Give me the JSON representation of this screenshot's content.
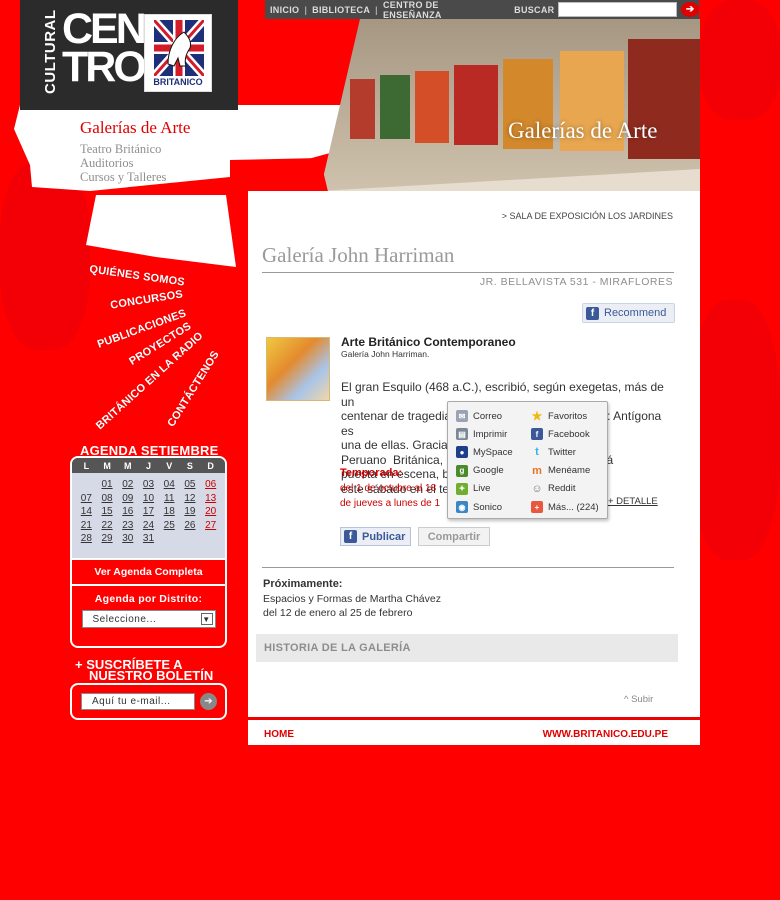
{
  "topnav": {
    "links": [
      "INICIO",
      "BIBLIOTECA",
      "CENTRO DE ENSEÑANZA"
    ],
    "search_label": "BUSCAR",
    "search_value": ""
  },
  "logo": {
    "cultural": "CULTURAL",
    "centro_line1": "CEN",
    "centro_line2": "TRO",
    "britanico": "BRITANICO"
  },
  "header": {
    "gallery_title": "Galerías de Arte"
  },
  "submenu": {
    "active": "Galerías de Arte",
    "items": [
      "Teatro Británico",
      "Auditorios",
      "Cursos y Talleres"
    ]
  },
  "left_menu": [
    "QUIÉNES SOMOS",
    "CONCURSOS",
    "PUBLICACIONES",
    "PROYECTOS",
    "BRITÁNICO EN LA RADIO",
    "CONTÁCTENOS"
  ],
  "agenda": {
    "title": "AGENDA SETIEMBRE",
    "weekdays": [
      "L",
      "M",
      "M",
      "J",
      "V",
      "S",
      "D"
    ],
    "days": [
      "01",
      "02",
      "03",
      "04",
      "05",
      "06",
      "07",
      "08",
      "09",
      "10",
      "11",
      "12",
      "13",
      "14",
      "15",
      "16",
      "17",
      "18",
      "19",
      "20",
      "21",
      "22",
      "23",
      "24",
      "25",
      "26",
      "27",
      "28",
      "29",
      "30",
      "31"
    ],
    "full_link": "Ver Agenda Completa",
    "district_label": "Agenda por Distrito:",
    "district_value": "Seleccione..."
  },
  "subscribe": {
    "title_line1": "+ SUSCRÍBETE A",
    "title_line2": "NUESTRO BOLETÍN",
    "email_placeholder": "Aquí tu e-mail..."
  },
  "content": {
    "breadcrumb": "> SALA DE EXPOSICIÓN LOS JARDINES",
    "gallery_name": "Galería John Harriman",
    "address": "JR. BELLAVISTA 531 - MIRAFLORES",
    "recommend": "Recommend",
    "article_title": "Arte Británico Contemporaneo",
    "article_sub": "Galería John Harriman.",
    "body_lines": [
      "El gran Esquilo (468 a.C.), escribió, según exegetas, más de un",
      "centenar de tragedias. Apenas se conservan siete: Antígona es",
      "una de ellas. Gracias                       ación Cultural",
      "Peruano  Británica,                                griego  será",
      "puesta en escena, b                          geles, desde",
      "este sábado en el te"
    ],
    "season_label": "Temporada:",
    "season_line1": "del 1 de octubre al 18",
    "season_line2": "de jueves a lunes de 1",
    "more_detail": "+ DETALLE",
    "publish": "Publicar",
    "share": "Compartir",
    "upcoming_label": "Próximamente:",
    "upcoming_line1": "Espacios y Formas de Martha Chávez",
    "upcoming_line2": "del 12 de enero al 25 de febrero",
    "history": "HISTORIA DE LA GALERÍA",
    "up": "^ Subir"
  },
  "share_menu": [
    {
      "label": "Correo",
      "icon": "mail-icon",
      "color": "#9aa3b5"
    },
    {
      "label": "Favoritos",
      "icon": "star-icon",
      "color": "#f1b814"
    },
    {
      "label": "Imprimir",
      "icon": "printer-icon",
      "color": "#7d8896"
    },
    {
      "label": "Facebook",
      "icon": "facebook-icon",
      "color": "#3b5998"
    },
    {
      "label": "MySpace",
      "icon": "myspace-icon",
      "color": "#1e3f8a"
    },
    {
      "label": "Twitter",
      "icon": "twitter-icon",
      "color": "#2fb5e8"
    },
    {
      "label": "Google",
      "icon": "google-icon",
      "color": "#4a8b2c"
    },
    {
      "label": "Menéame",
      "icon": "meneame-icon",
      "color": "#e4752b"
    },
    {
      "label": "Live",
      "icon": "live-icon",
      "color": "#6fae2f"
    },
    {
      "label": "Reddit",
      "icon": "reddit-icon",
      "color": "#777777"
    },
    {
      "label": "Sonico",
      "icon": "sonico-icon",
      "color": "#3a86c6"
    },
    {
      "label": "Más... (224)",
      "icon": "more-icon",
      "color": "#e9573c"
    }
  ],
  "footer": {
    "home": "HOME",
    "url": "WWW.BRITANICO.EDU.PE"
  }
}
